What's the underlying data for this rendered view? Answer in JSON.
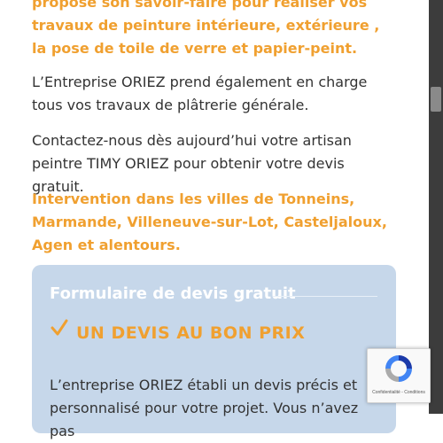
{
  "content": {
    "intro_highlight": "propose son savoir-faire pour réaliser vos travaux de peinture intérieure, extérieure , la pose de toile de verre et papier-peint.",
    "plastering_text": "L’Entreprise ORIEZ prend également en charge tous vos travaux de plâtrerie générale.",
    "contact_text": "Contactez-nous dès aujourd’hui votre artisan peintre TIMY ORIEZ pour obtenir votre devis gratuit.",
    "intervention_text": "Intervention dans les villes de Tonneins, Marmande, Villeneuve-sur-Lot, Casteljaloux, Agen et alentours."
  },
  "quote_card": {
    "title": "Formulaire de devis gratuit",
    "subtitle": "UN DEVIS AU BON PRIX",
    "description": "L’entreprise ORIEZ établi un devis précis et personnalisé pour votre projet. Vous n’avez pas"
  },
  "recaptcha": {
    "footer": "Confidentialité - Conditions"
  },
  "colors": {
    "accent_orange": "#f0a030",
    "card_bg": "#c6d7ea",
    "body_text": "#333333"
  },
  "icons": [
    "checkmark-icon",
    "recaptcha-icon"
  ]
}
